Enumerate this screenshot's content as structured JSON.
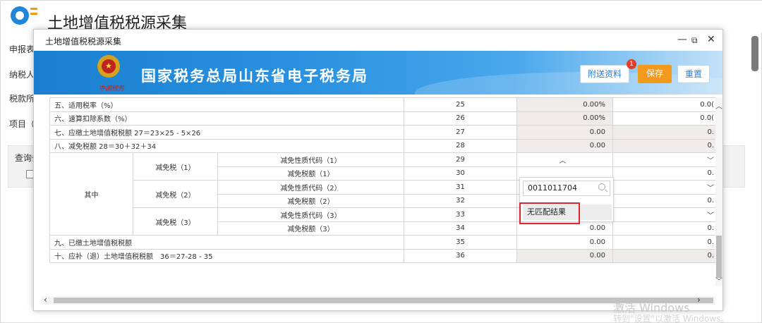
{
  "page": {
    "title": "土地增值税税源采集",
    "labels": [
      "申报表",
      "纳税人",
      "税款所",
      "项目（"
    ],
    "query_label": "查询条"
  },
  "modal": {
    "title": "土地增值税税源采集",
    "minimize": "—",
    "restore": "⧉",
    "close": "✕",
    "banner_title": "国家税务总局山东省电子税务局",
    "emblem_text": "中国税务",
    "buttons": {
      "attach": "附送资料",
      "save": "保存",
      "reset": "重置"
    },
    "badge": "1"
  },
  "table": {
    "rows": [
      {
        "label": "五、适用税率（%）",
        "no": "25",
        "v1": "0.00%",
        "v2": "0.0("
      },
      {
        "label": "六、速算扣除系数（%）",
        "no": "26",
        "v1": "0.00%",
        "v2": "0.0("
      },
      {
        "label": "七、应缴土地增值税税额 27＝23×25 - 5×26",
        "no": "27",
        "v1": "0.00",
        "v2": "0."
      },
      {
        "label": "八、减免税额 28＝30＋32＋34",
        "no": "28",
        "v1": "0.00",
        "v2": "0."
      }
    ],
    "group_label": "其中",
    "sub": [
      {
        "name": "减免税（1）",
        "code_label": "减免性质代码（1）",
        "code_no": "29",
        "amt_label": "减免税额（1）",
        "amt_no": "30",
        "amt_v2": "0."
      },
      {
        "name": "减免税（2）",
        "code_label": "减免性质代码（2）",
        "code_no": "31",
        "amt_label": "减免税额（2）",
        "amt_no": "32",
        "amt_v2": "0."
      },
      {
        "name": "减免税（3）",
        "code_label": "减免性质代码（3）",
        "code_no": "33",
        "amt_label": "减免税额（3）",
        "amt_no": "34",
        "amt_v1": "0.00",
        "amt_v2": "0."
      }
    ],
    "tail": [
      {
        "label": "九、已缴土地增值税税额",
        "no": "35",
        "v1": "0.00",
        "v2": "0."
      },
      {
        "label": "十、应补（退）土地增值税税额　36＝27-28 - 35",
        "no": "36",
        "v1": "0.00",
        "v2": "0."
      }
    ]
  },
  "dropdown": {
    "input_value": "0011011704",
    "no_match": "无匹配结果"
  },
  "watermark": {
    "line1": "激活 Windows",
    "line2": "转到\"设置\"以激活 Windows。"
  }
}
